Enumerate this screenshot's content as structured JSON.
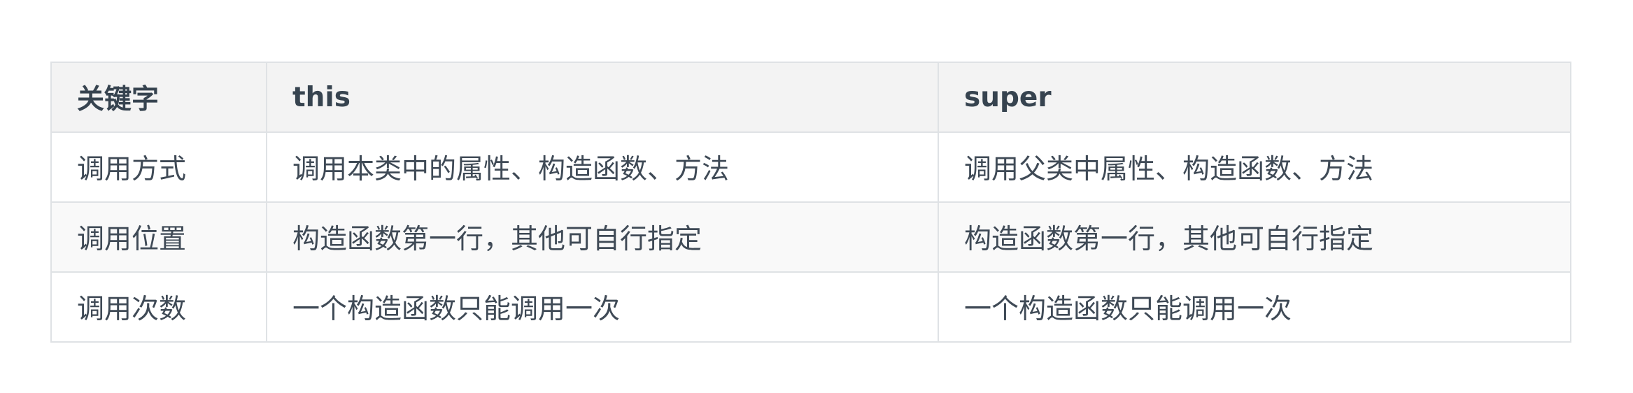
{
  "table": {
    "headers": [
      "关键字",
      "this",
      "super"
    ],
    "rows": [
      [
        "调用方式",
        "调用本类中的属性、构造函数、方法",
        "调用父类中属性、构造函数、方法"
      ],
      [
        "调用位置",
        "构造函数第一行，其他可自行指定",
        "构造函数第一行，其他可自行指定"
      ],
      [
        "调用次数",
        "一个构造函数只能调用一次",
        "一个构造函数只能调用一次"
      ]
    ]
  },
  "colors": {
    "border": "#dfe2e5",
    "header_bg": "#f3f3f3",
    "striped_row_bg": "#f9f9f9",
    "text": "#3f4a56"
  }
}
